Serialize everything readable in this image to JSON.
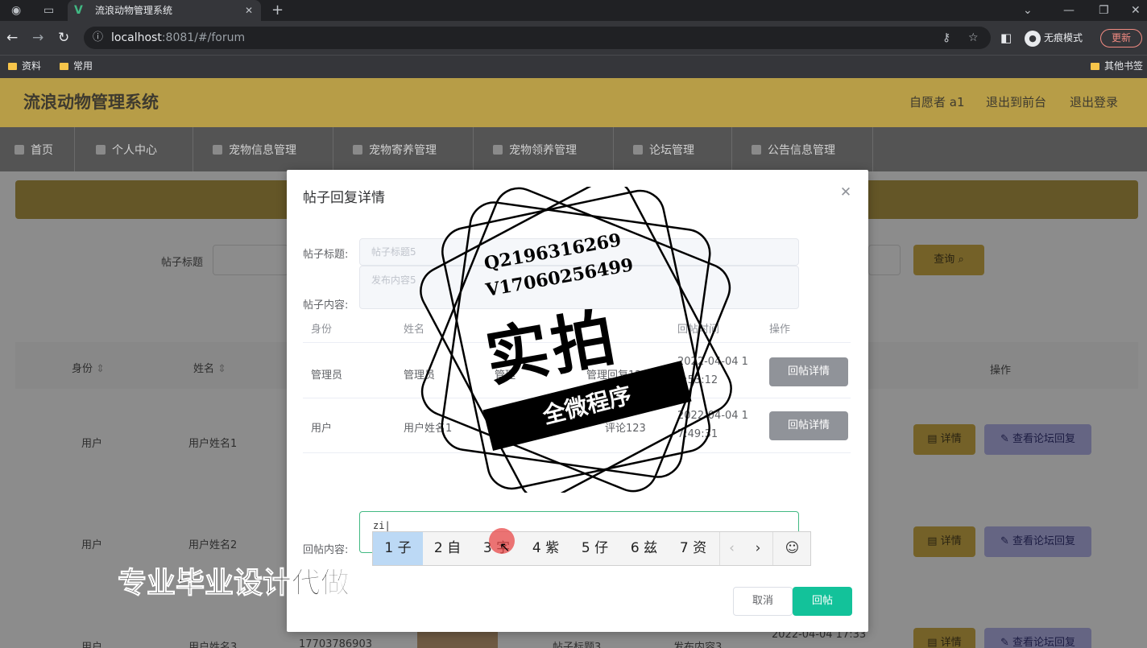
{
  "browser": {
    "tab_title": "流浪动物管理系统",
    "url_host": "localhost",
    "url_rest": ":8081/#/forum",
    "incognito_label": "无痕模式",
    "update_label": "更新",
    "bookmarks": [
      "资料",
      "常用"
    ],
    "bookmarks_other": "其他书签"
  },
  "app": {
    "title": "流浪动物管理系统",
    "user_label": "自愿者 a1",
    "to_front_label": "退出到前台",
    "logout_label": "退出登录",
    "menu": [
      "首页",
      "个人中心",
      "宠物信息管理",
      "宠物寄养管理",
      "宠物领养管理",
      "论坛管理",
      "公告信息管理"
    ]
  },
  "background": {
    "search_label": "帖子标题",
    "search_button": "查询",
    "columns": [
      "身份",
      "姓名"
    ],
    "ops_header": "操作",
    "rows": [
      {
        "role": "用户",
        "name": "用户姓名1"
      },
      {
        "role": "用户",
        "name": "用户姓名2"
      },
      {
        "role": "用户",
        "name": "用户姓名3",
        "phone": "17703786903",
        "title": "帖子标题3",
        "content": "发布内容3",
        "time": "2022-04-04 17:33"
      }
    ],
    "detail_button": "详情",
    "view_replies_button": "查看论坛回复"
  },
  "dialog": {
    "title": "帖子回复详情",
    "post_title_label": "帖子标题:",
    "post_title_value": "帖子标题5",
    "post_content_label": "帖子内容:",
    "post_content_value": "发布内容5",
    "columns": [
      "身份",
      "姓名",
      "回帖时间",
      "操作"
    ],
    "rows": [
      {
        "role": "管理员",
        "name": "管理员",
        "phone": "管理",
        "content": "管理回复123",
        "time1": "2022-04-04 1",
        "time2": "7:53:12",
        "action": "回帖详情"
      },
      {
        "role": "用户",
        "name": "用户姓名1",
        "phone": "17703",
        "content": "评论123",
        "time1": "2022-04-04 1",
        "time2": "7:49:31",
        "action": "回帖详情"
      }
    ],
    "reply_label": "回帖内容:",
    "reply_value": "zi",
    "cancel_label": "取消",
    "submit_label": "回帖"
  },
  "ime": {
    "candidates": [
      "1 子",
      "2 自",
      "3 字",
      "4 紫",
      "5 仔",
      "6 兹",
      "7 资"
    ],
    "prev": "‹",
    "next": "›",
    "emoji": "☺"
  },
  "watermark": {
    "contact1": "Q2196316269",
    "contact2": "V17060256499",
    "big_text": "实拍",
    "ribbon": "全微程序",
    "bottom_text": "专业毕业设计代做"
  }
}
